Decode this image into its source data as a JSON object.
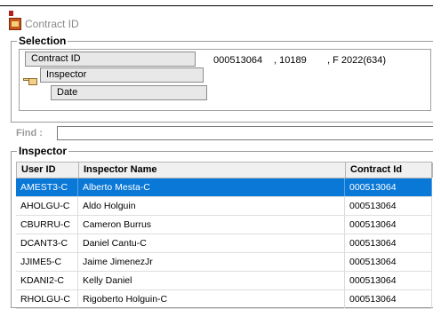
{
  "window": {
    "title": "Contract ID"
  },
  "selection": {
    "group_title": "Selection",
    "buttons": {
      "contract_id": "Contract ID",
      "inspector": "Inspector",
      "date": "Date"
    },
    "values": {
      "contract": "000513064",
      "number": ", 10189",
      "code": ", F 2022(634)"
    }
  },
  "find": {
    "label": "Find :",
    "value": ""
  },
  "inspector": {
    "group_title": "Inspector",
    "columns": [
      "User ID",
      "Inspector Name",
      "Contract Id"
    ],
    "rows": [
      {
        "user_id": "AMEST3-C",
        "name": "Alberto Mesta-C",
        "contract": "000513064",
        "selected": true
      },
      {
        "user_id": "AHOLGU-C",
        "name": "Aldo Holguin",
        "contract": "000513064",
        "selected": false
      },
      {
        "user_id": "CBURRU-C",
        "name": "Cameron Burrus",
        "contract": "000513064",
        "selected": false
      },
      {
        "user_id": "DCANT3-C",
        "name": "Daniel Cantu-C",
        "contract": "000513064",
        "selected": false
      },
      {
        "user_id": "JJIME5-C",
        "name": "Jaime JimenezJr",
        "contract": "000513064",
        "selected": false
      },
      {
        "user_id": "KDANI2-C",
        "name": "Kelly Daniel",
        "contract": "000513064",
        "selected": false
      },
      {
        "user_id": "RHOLGU-C",
        "name": "Rigoberto Holguin-C",
        "contract": "000513064",
        "selected": false
      }
    ]
  },
  "colors": {
    "selection_highlight": "#0a78d7",
    "title_text": "#8a8a8a"
  }
}
